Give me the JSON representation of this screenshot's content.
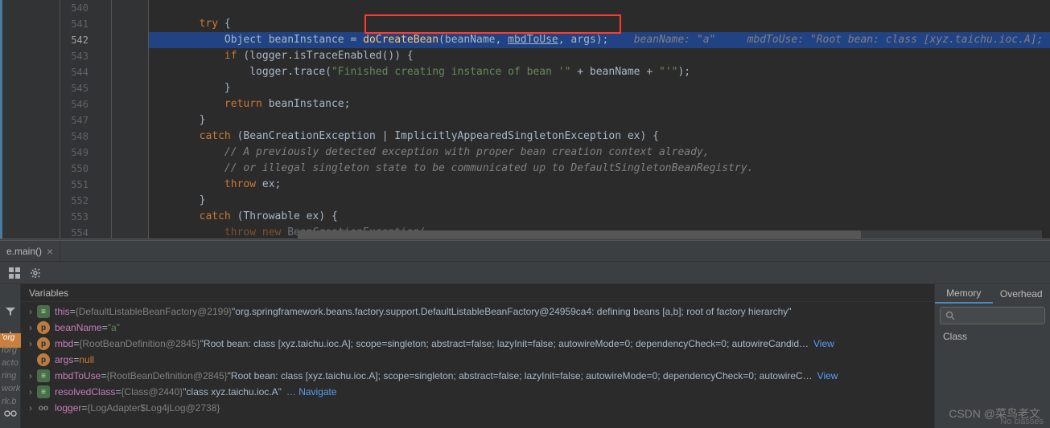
{
  "editor": {
    "lines": [
      {
        "num": "540",
        "indent": "",
        "code": ""
      },
      {
        "num": "541",
        "indent": "        ",
        "kw": "try",
        "rest": " {"
      },
      {
        "num": "542",
        "highlighted": true,
        "indent": "            ",
        "type": "Object",
        "var": " beanInstance = ",
        "method": "doCreateBean",
        "args_open": "(beanName, ",
        "underlined": "mbdToUse",
        "args_close": ", args);",
        "hint": "    beanName: \"a\"     mbdToUse: \"Root bean: class [xyz.taichu.ioc.A];"
      },
      {
        "num": "543",
        "indent": "            ",
        "kw": "if",
        "rest": " (logger.isTraceEnabled()) {"
      },
      {
        "num": "544",
        "indent": "                ",
        "code": "logger.trace(",
        "str": "\"Finished creating instance of bean '\"",
        "mid": " + beanName + ",
        "str2": "\"'\"",
        "end": ");"
      },
      {
        "num": "545",
        "indent": "            ",
        "code": "}"
      },
      {
        "num": "546",
        "indent": "            ",
        "kw": "return",
        "rest": " beanInstance;"
      },
      {
        "num": "547",
        "indent": "        ",
        "code": "}"
      },
      {
        "num": "548",
        "indent": "        ",
        "kw": "catch",
        "rest": " (BeanCreationException | ImplicitlyAppearedSingletonException ex) {"
      },
      {
        "num": "549",
        "indent": "            ",
        "comment": "// A previously detected exception with proper bean creation context already,"
      },
      {
        "num": "550",
        "indent": "            ",
        "comment": "// or illegal singleton state to be communicated up to DefaultSingletonBeanRegistry."
      },
      {
        "num": "551",
        "indent": "            ",
        "kw": "throw",
        "rest": " ex;"
      },
      {
        "num": "552",
        "indent": "        ",
        "code": "}"
      },
      {
        "num": "553",
        "indent": "        ",
        "kw": "catch",
        "rest": " (Throwable ex) {"
      },
      {
        "num": "554",
        "indent": "            ",
        "partial_kw": "throw new",
        "partial_rest": " BeanCreationException("
      }
    ]
  },
  "tab": {
    "label": "e.main()"
  },
  "vars_header": "Variables",
  "variables": [
    {
      "icon": "eq",
      "name": "this",
      "eq": " = ",
      "type": "{DefaultListableBeanFactory@2199}",
      "val": " \"org.springframework.beans.factory.support.DefaultListableBeanFactory@24959ca4: defining beans [a,b]; root of factory hierarchy\"",
      "arrow": true
    },
    {
      "icon": "p",
      "name": "beanName",
      "eq": " = ",
      "str": "\"a\"",
      "arrow": true
    },
    {
      "icon": "p",
      "name": "mbd",
      "eq": " = ",
      "type": "{RootBeanDefinition@2845}",
      "val": " \"Root bean: class [xyz.taichu.ioc.A]; scope=singleton; abstract=false; lazyInit=false; autowireMode=0; dependencyCheck=0; autowireCandid…",
      "view": "View",
      "arrow": true
    },
    {
      "icon": "p",
      "name": "args",
      "eq": " = ",
      "kw": "null",
      "arrow": false
    },
    {
      "icon": "eq",
      "name": "mbdToUse",
      "eq": " = ",
      "type": "{RootBeanDefinition@2845}",
      "val": " \"Root bean: class [xyz.taichu.ioc.A]; scope=singleton; abstract=false; lazyInit=false; autowireMode=0; dependencyCheck=0; autowireC…",
      "view": "View",
      "arrow": true
    },
    {
      "icon": "eq",
      "name": "resolvedClass",
      "eq": " = ",
      "type": "{Class@2440}",
      "val": " \"class xyz.taichu.ioc.A\"",
      "nav": "… Navigate",
      "arrow": true
    },
    {
      "icon": "oo",
      "name": "logger",
      "eq": " = ",
      "type": "{LogAdapter$Log4jLog@2738}",
      "arrow": true
    }
  ],
  "right": {
    "tab1": "Memory",
    "tab2": "Overhead",
    "search_placeholder": "",
    "class_label": "Class"
  },
  "left_labels": [
    "forg",
    "acto",
    "ring",
    "work",
    "rk.b"
  ],
  "orange_label": "'org",
  "watermark": "CSDN @菜鸟老文",
  "no_classes": "No classes"
}
